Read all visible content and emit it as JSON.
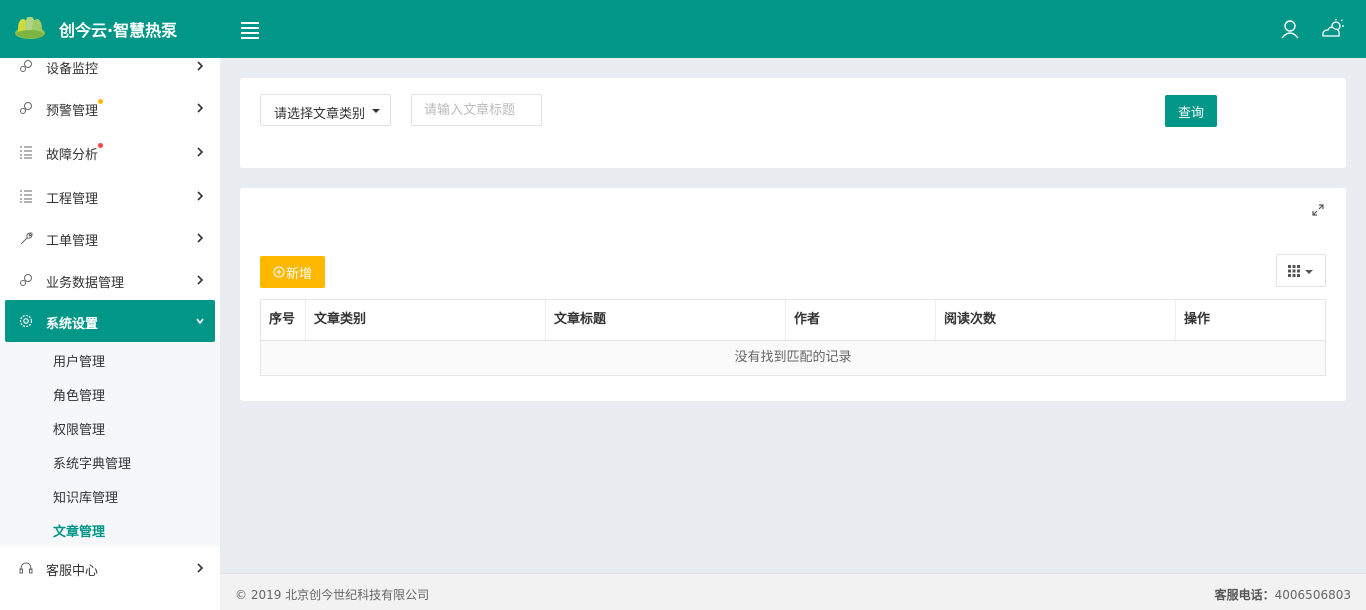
{
  "header": {
    "brand": "创今云·智慧热泵"
  },
  "sidebar": {
    "items": [
      {
        "label": "设备监控",
        "icon": "gears-icon"
      },
      {
        "label": "预警管理",
        "icon": "gears-icon",
        "dot_color": "#ffb800"
      },
      {
        "label": "故障分析",
        "icon": "list-icon",
        "dot_color": "#ff4444"
      },
      {
        "label": "工程管理",
        "icon": "list-icon"
      },
      {
        "label": "工单管理",
        "icon": "wrench-icon"
      },
      {
        "label": "业务数据管理",
        "icon": "gears-icon"
      },
      {
        "label": "系统设置",
        "icon": "settings-icon",
        "active": true
      },
      {
        "label": "客服中心",
        "icon": "headset-icon"
      }
    ],
    "submenu": [
      {
        "label": "用户管理"
      },
      {
        "label": "角色管理"
      },
      {
        "label": "权限管理"
      },
      {
        "label": "系统字典管理"
      },
      {
        "label": "知识库管理"
      },
      {
        "label": "文章管理",
        "active": true
      }
    ]
  },
  "filter": {
    "category_select": "请选择文章类别",
    "title_placeholder": "请输入文章标题",
    "query_button": "查询"
  },
  "toolbar": {
    "add_button": "新增"
  },
  "table": {
    "columns": [
      "序号",
      "文章类别",
      "文章标题",
      "作者",
      "阅读次数",
      "操作"
    ],
    "empty_text": "没有找到匹配的记录"
  },
  "footer": {
    "copyright": "© 2019 北京创今世纪科技有限公司",
    "hotline_label": "客服电话：",
    "hotline_number": "4006506803"
  },
  "colors": {
    "primary": "#009688",
    "warning": "#ffb800"
  }
}
